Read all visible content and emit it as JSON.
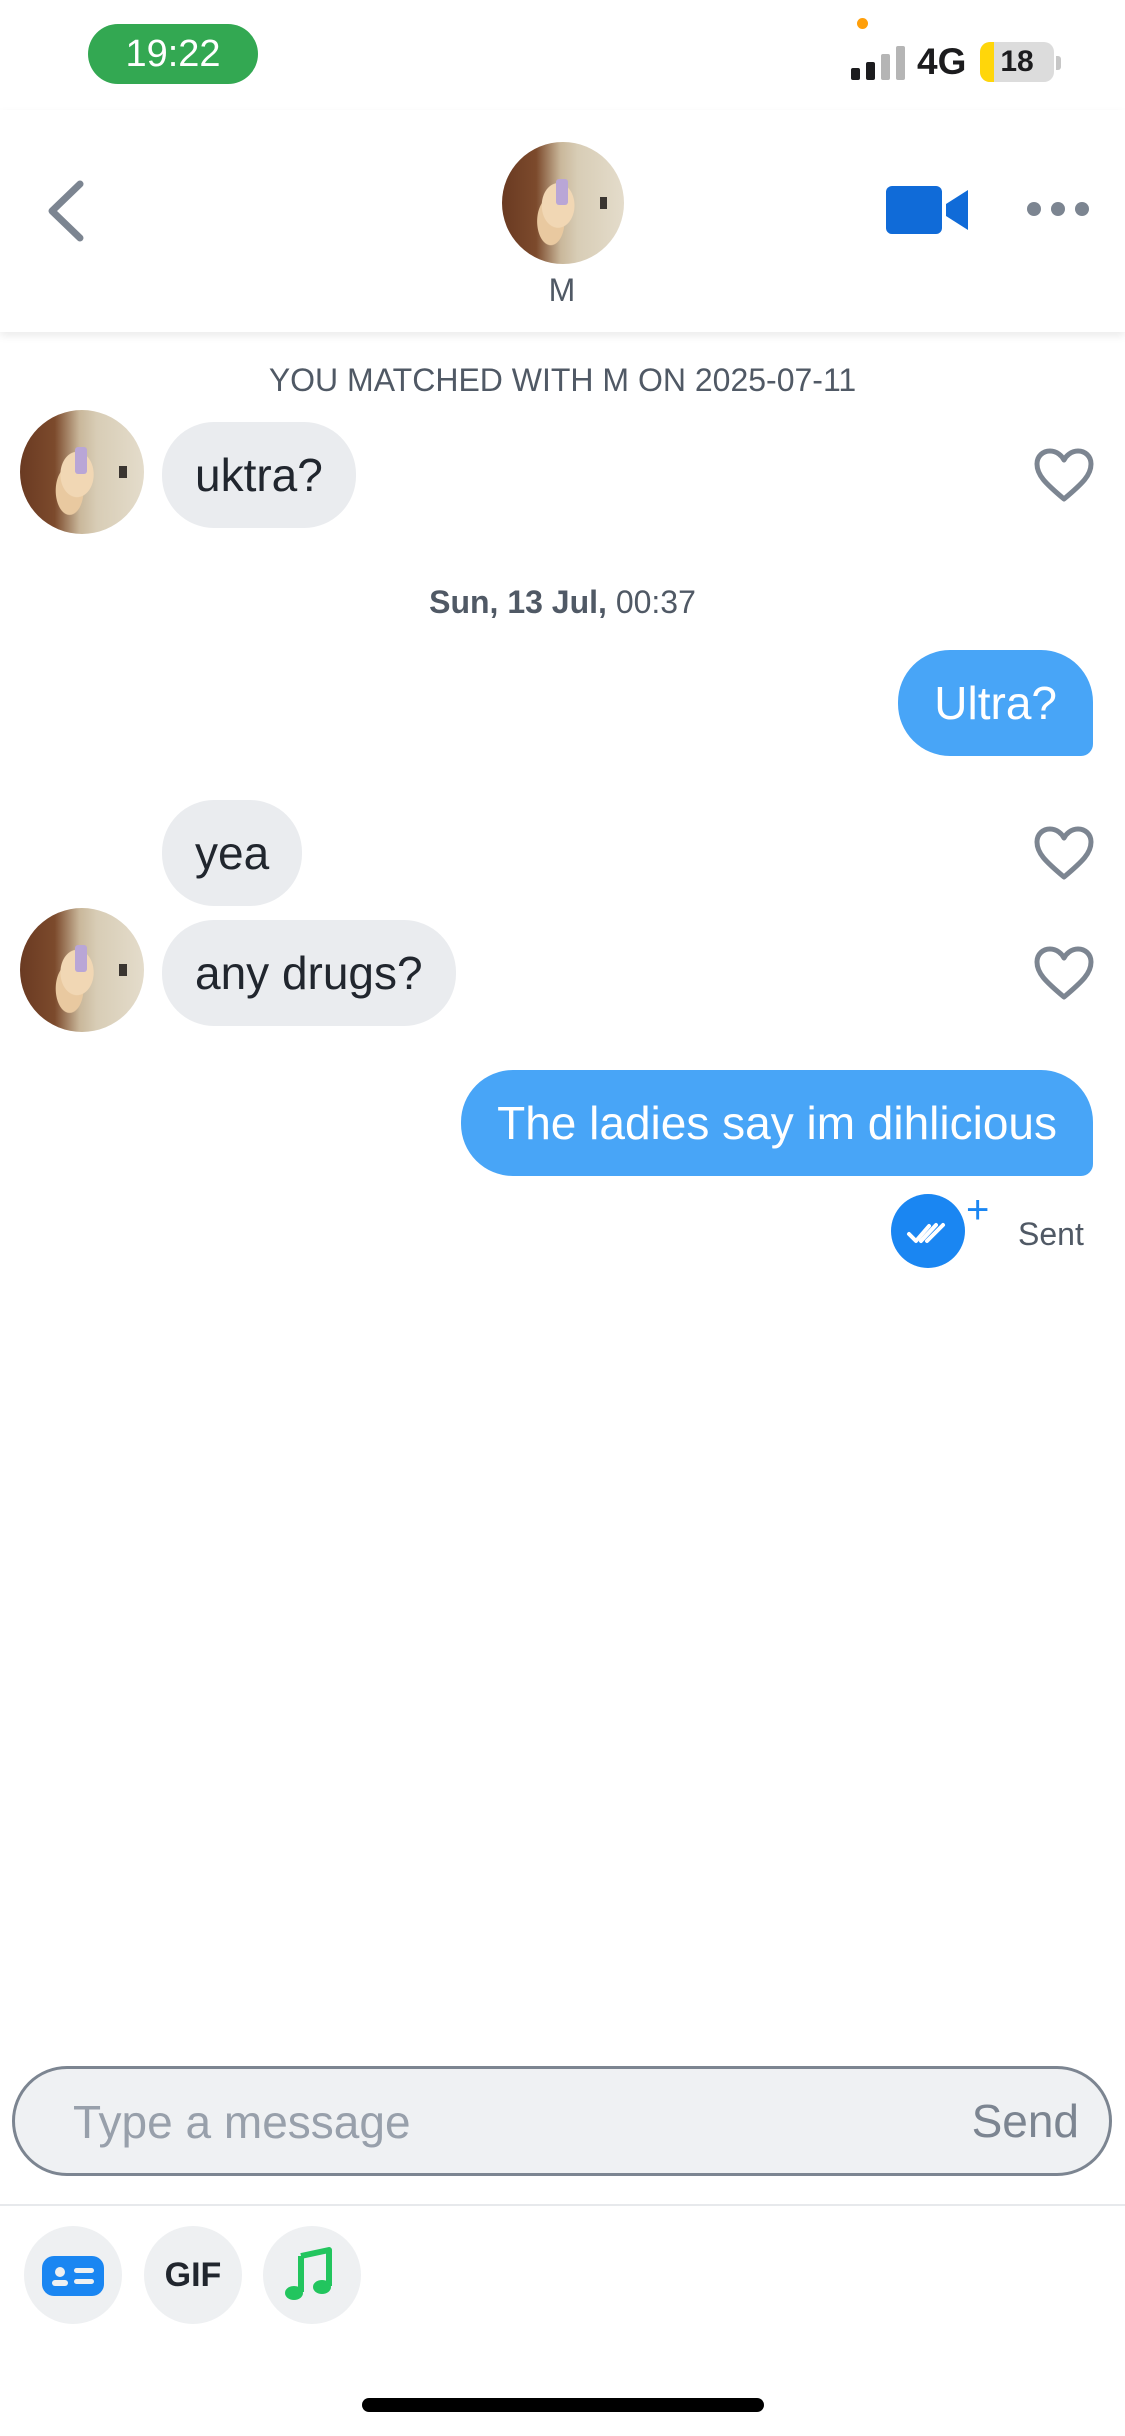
{
  "status_bar": {
    "time": "19:22",
    "network": "4G",
    "battery_level": "18",
    "signal_icon": "cellular-signal-icon",
    "battery_icon": "battery-icon"
  },
  "header": {
    "name": "M",
    "back_icon": "chevron-left-icon",
    "video_icon": "video-camera-icon",
    "more_icon": "more-horizontal-icon"
  },
  "chat": {
    "match_notice": "YOU MATCHED WITH M ON 2025-07-11",
    "date_separator_day": "Sun, 13 Jul,",
    "date_separator_time": " 00:37",
    "messages": [
      {
        "from": "them",
        "text": "uktra?"
      },
      {
        "from": "me",
        "text": "Ultra?"
      },
      {
        "from": "them",
        "text": "yea"
      },
      {
        "from": "them",
        "text": "any drugs?"
      },
      {
        "from": "me",
        "text": "The ladies say im dihlicious"
      }
    ],
    "status": "Sent"
  },
  "composer": {
    "placeholder": "Type a message",
    "send_label": "Send"
  },
  "toolbar": {
    "gif_label": "GIF",
    "icons": [
      "id-card-icon",
      "gif-icon",
      "music-note-icon"
    ]
  },
  "colors": {
    "outgoing_bubble": "#48a5f7",
    "incoming_bubble": "#eaecef",
    "accent": "#1a86f2",
    "status_pill": "#33a852",
    "music_green": "#22c55e"
  }
}
